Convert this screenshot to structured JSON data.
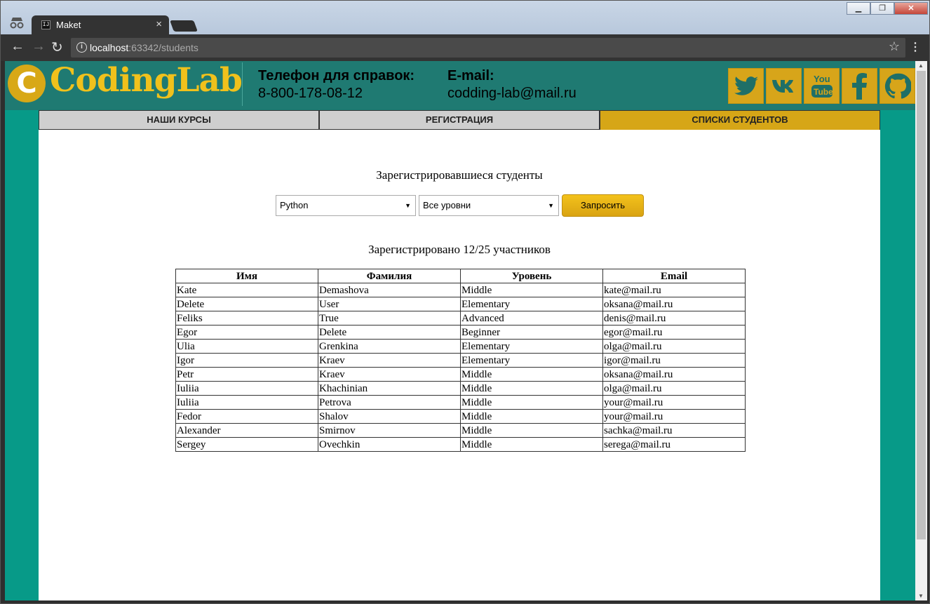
{
  "browser": {
    "tab_title": "Maket",
    "tab_favicon": "IJ",
    "url_host": "localhost",
    "url_rest": ":63342/students"
  },
  "site": {
    "logo_letter": "C",
    "logo_text": "CodingLab",
    "phone_label": "Телефон для справок:",
    "phone": "8-800-178-08-12",
    "email_label": "E-mail:",
    "email": "codding-lab@mail.ru",
    "social": [
      "twitter-icon",
      "vk-icon",
      "youtube-icon",
      "facebook-icon",
      "github-icon"
    ],
    "colors": {
      "teal": "#079a88",
      "header": "#1f7a72",
      "gold": "#d6a617"
    }
  },
  "menu": [
    "НАШИ КУРСЫ",
    "РЕГИСТРАЦИЯ",
    "СПИСКИ СТУДЕНТОВ"
  ],
  "page": {
    "title": "Зарегистрировавшиеся студенты",
    "course_select": "Python",
    "level_select": "Все уровни",
    "request_button": "Запросить",
    "count_text": "Зарегистрировано 12/25 участников"
  },
  "table": {
    "headers": [
      "Имя",
      "Фамилия",
      "Уровень",
      "Email"
    ],
    "rows": [
      [
        "Kate",
        "Demashova",
        "Middle",
        "kate@mail.ru"
      ],
      [
        "Delete",
        "User",
        "Elementary",
        "oksana@mail.ru"
      ],
      [
        "Feliks",
        "True",
        "Advanced",
        "denis@mail.ru"
      ],
      [
        "Egor",
        "Delete",
        "Beginner",
        "egor@mail.ru"
      ],
      [
        "Ulia",
        "Grenkina",
        "Elementary",
        "olga@mail.ru"
      ],
      [
        "Igor",
        "Kraev",
        "Elementary",
        "igor@mail.ru"
      ],
      [
        "Petr",
        "Kraev",
        "Middle",
        "oksana@mail.ru"
      ],
      [
        "Iuliia",
        "Khachinian",
        "Middle",
        "olga@mail.ru"
      ],
      [
        "Iuliia",
        "Petrova",
        "Middle",
        "your@mail.ru"
      ],
      [
        "Fedor",
        "Shalov",
        "Middle",
        "your@mail.ru"
      ],
      [
        "Alexander",
        "Smirnov",
        "Middle",
        "sachka@mail.ru"
      ],
      [
        "Sergey",
        "Ovechkin",
        "Middle",
        "serega@mail.ru"
      ]
    ]
  }
}
